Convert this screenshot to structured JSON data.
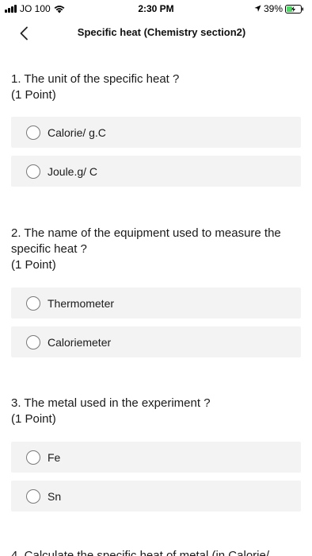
{
  "status_bar": {
    "carrier": "JO 100",
    "time": "2:30 PM",
    "battery": "39%",
    "icons": [
      "signal-icon",
      "wifi-icon",
      "location-icon",
      "battery-charging-icon"
    ]
  },
  "nav": {
    "title": "Specific heat  (Chemistry section2)",
    "back_icon": "chevron-left-icon"
  },
  "questions": [
    {
      "text": "1. The unit of the specific heat ?",
      "points": "(1 Point)",
      "options": [
        "Calorie/ g.C",
        "Joule.g/ C"
      ]
    },
    {
      "text": "2. The name of the equipment used to measure the specific heat ?",
      "points": "(1 Point)",
      "options": [
        "Thermometer",
        "Caloriemeter"
      ]
    },
    {
      "text": "3. The metal used in the experiment ?",
      "points": "(1 Point)",
      "options": [
        "Fe",
        "Sn"
      ]
    },
    {
      "text": "4. Calculate the specific heat of metal (in Calorie/"
    }
  ]
}
